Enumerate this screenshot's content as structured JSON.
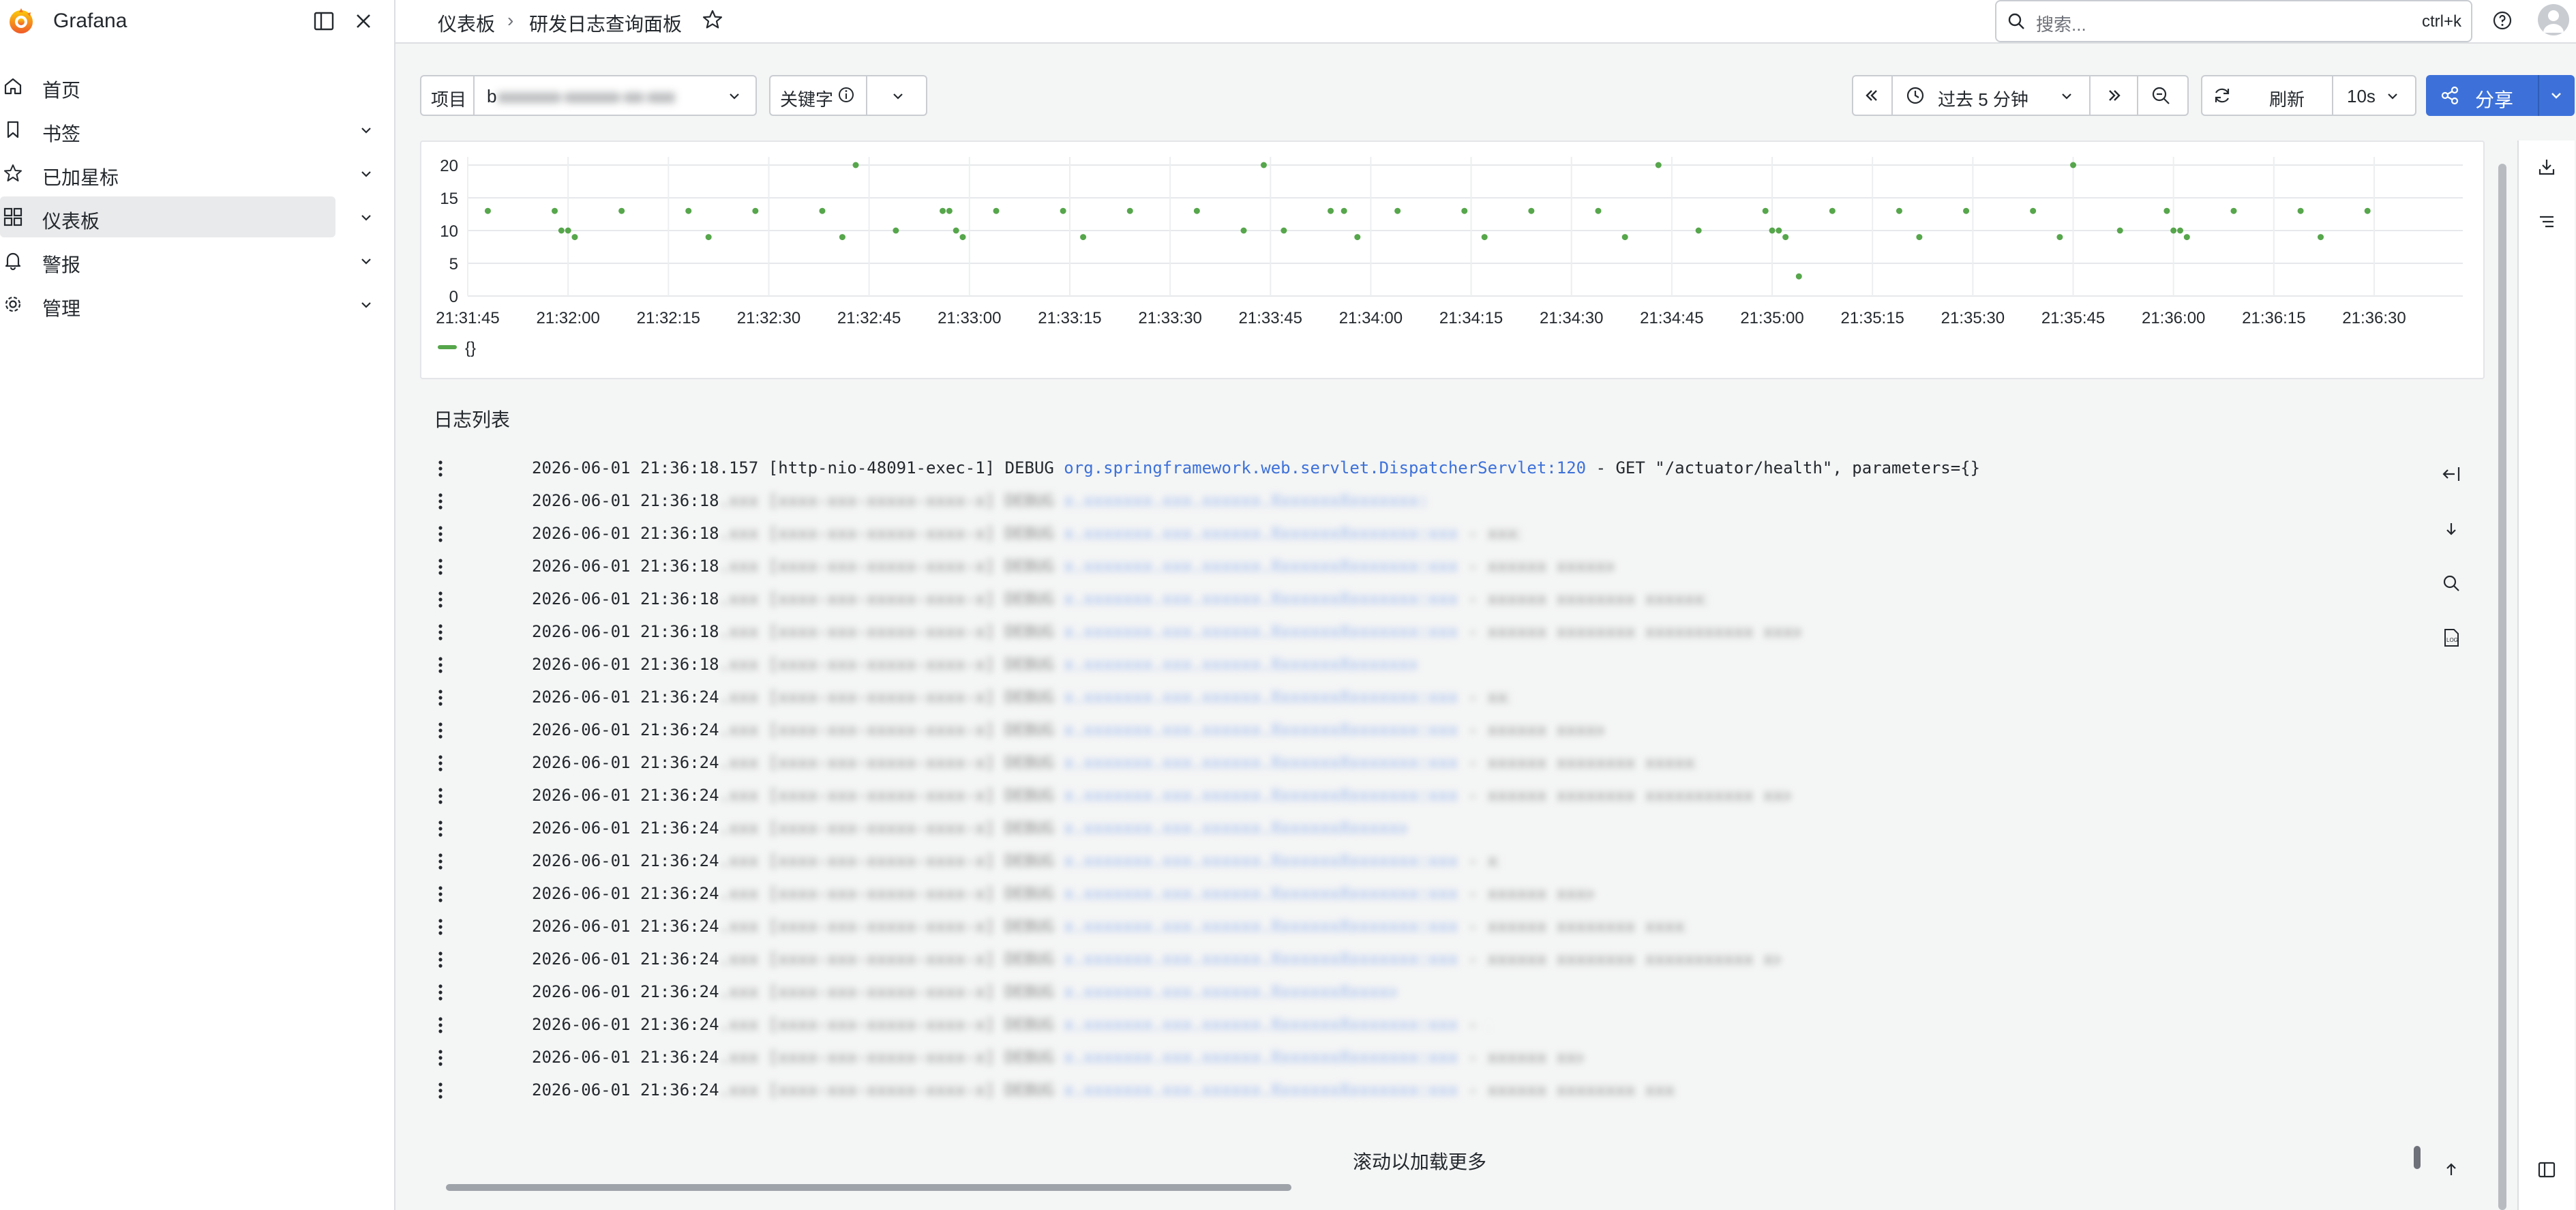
{
  "app": {
    "name": "Grafana"
  },
  "sidebar": {
    "items": [
      {
        "label": "首页",
        "icon": "home-icon",
        "expandable": false,
        "active": false
      },
      {
        "label": "书签",
        "icon": "bookmark-icon",
        "expandable": true,
        "active": false
      },
      {
        "label": "已加星标",
        "icon": "star-icon",
        "expandable": true,
        "active": false
      },
      {
        "label": "仪表板",
        "icon": "apps-icon",
        "expandable": true,
        "active": true
      },
      {
        "label": "警报",
        "icon": "bell-icon",
        "expandable": true,
        "active": false
      },
      {
        "label": "管理",
        "icon": "cog-icon",
        "expandable": true,
        "active": false
      }
    ]
  },
  "topbar": {
    "breadcrumb": [
      "仪表板",
      "研发日志查询面板"
    ],
    "search_placeholder": "搜索...",
    "search_shortcut": "ctrl+k"
  },
  "controls": {
    "project_label": "项目",
    "project_value": "b",
    "keyword_label": "关键字",
    "time_range": "过去 5 分钟",
    "refresh_label": "刷新",
    "refresh_interval": "10s",
    "share_label": "分享"
  },
  "chart_data": {
    "type": "scatter",
    "title": "",
    "xlabel": "",
    "ylabel": "",
    "ylim": [
      0,
      20
    ],
    "yticks": [
      "20",
      "15",
      "10",
      "5",
      "0"
    ],
    "xticks": [
      "21:31:45",
      "21:32:00",
      "21:32:15",
      "21:32:30",
      "21:32:45",
      "21:33:00",
      "21:33:15",
      "21:33:30",
      "21:33:45",
      "21:34:00",
      "21:34:15",
      "21:34:30",
      "21:34:45",
      "21:35:00",
      "21:35:15",
      "21:35:30",
      "21:35:45",
      "21:36:00",
      "21:36:15",
      "21:36:30"
    ],
    "grid": true,
    "legend": "bottom-left",
    "series": [
      {
        "name": "{}",
        "color": "#56a64b",
        "points": [
          [
            "21:31:48",
            13
          ],
          [
            "21:31:58",
            13
          ],
          [
            "21:31:59",
            10
          ],
          [
            "21:32:00",
            10
          ],
          [
            "21:32:01",
            9
          ],
          [
            "21:32:08",
            13
          ],
          [
            "21:32:18",
            13
          ],
          [
            "21:32:21",
            9
          ],
          [
            "21:32:28",
            13
          ],
          [
            "21:32:38",
            13
          ],
          [
            "21:32:41",
            9
          ],
          [
            "21:32:43",
            20
          ],
          [
            "21:32:49",
            10
          ],
          [
            "21:32:56",
            13
          ],
          [
            "21:32:57",
            13
          ],
          [
            "21:32:58",
            10
          ],
          [
            "21:32:59",
            9
          ],
          [
            "21:33:04",
            13
          ],
          [
            "21:33:14",
            13
          ],
          [
            "21:33:17",
            9
          ],
          [
            "21:33:24",
            13
          ],
          [
            "21:33:34",
            13
          ],
          [
            "21:33:41",
            10
          ],
          [
            "21:33:44",
            20
          ],
          [
            "21:33:47",
            10
          ],
          [
            "21:33:54",
            13
          ],
          [
            "21:33:56",
            13
          ],
          [
            "21:33:58",
            9
          ],
          [
            "21:34:04",
            13
          ],
          [
            "21:34:14",
            13
          ],
          [
            "21:34:17",
            9
          ],
          [
            "21:34:24",
            13
          ],
          [
            "21:34:34",
            13
          ],
          [
            "21:34:38",
            9
          ],
          [
            "21:34:43",
            20
          ],
          [
            "21:34:49",
            10
          ],
          [
            "21:34:59",
            13
          ],
          [
            "21:35:00",
            10
          ],
          [
            "21:35:01",
            10
          ],
          [
            "21:35:02",
            9
          ],
          [
            "21:35:04",
            3
          ],
          [
            "21:35:09",
            13
          ],
          [
            "21:35:19",
            13
          ],
          [
            "21:35:22",
            9
          ],
          [
            "21:35:29",
            13
          ],
          [
            "21:35:39",
            13
          ],
          [
            "21:35:43",
            9
          ],
          [
            "21:35:45",
            20
          ],
          [
            "21:35:52",
            10
          ],
          [
            "21:35:59",
            13
          ],
          [
            "21:36:00",
            10
          ],
          [
            "21:36:01",
            10
          ],
          [
            "21:36:02",
            9
          ],
          [
            "21:36:09",
            13
          ],
          [
            "21:36:19",
            13
          ],
          [
            "21:36:22",
            9
          ],
          [
            "21:36:29",
            13
          ]
        ]
      }
    ]
  },
  "logs": {
    "title": "日志列表",
    "load_more": "滚动以加载更多",
    "first_line": {
      "time": "2026-06-01 21:36:18.157",
      "thread": "[http-nio-48091-exec-1]",
      "level": "DEBUG",
      "logger": "org.springframework.web.servlet.DispatcherServlet:120",
      "message": "- GET \"/actuator/health\", parameters={}"
    },
    "rows": [
      "2026-06-01 21:36:18",
      "2026-06-01 21:36:18",
      "2026-06-01 21:36:18",
      "2026-06-01 21:36:18",
      "2026-06-01 21:36:18",
      "2026-06-01 21:36:18",
      "2026-06-01 21:36:18",
      "2026-06-01 21:36:24",
      "2026-06-01 21:36:24",
      "2026-06-01 21:36:24",
      "2026-06-01 21:36:24",
      "2026-06-01 21:36:24",
      "2026-06-01 21:36:24",
      "2026-06-01 21:36:24",
      "2026-06-01 21:36:24",
      "2026-06-01 21:36:24",
      "2026-06-01 21:36:24",
      "2026-06-01 21:36:24",
      "2026-06-01 21:36:24",
      "2026-06-01 21:36:24"
    ]
  }
}
